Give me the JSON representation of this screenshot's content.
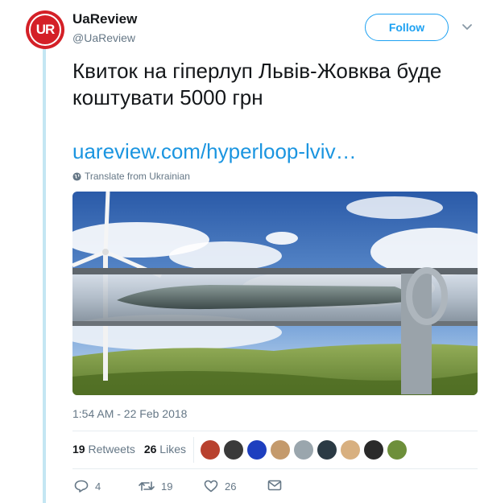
{
  "user": {
    "avatar_text": "UR",
    "name": "UaReview",
    "handle": "@UaReview"
  },
  "follow_label": "Follow",
  "tweet": {
    "line1": "Квиток на гіперлуп Львів-Жовква буде",
    "line2": "коштувати 5000 грн",
    "link": "uareview.com/hyperloop-lviv…",
    "translate_label": "Translate from Ukrainian"
  },
  "timestamp": "1:54 AM - 22 Feb 2018",
  "stats": {
    "retweets_count": "19",
    "retweets_label": "Retweets",
    "likes_count": "26",
    "likes_label": "Likes"
  },
  "likers": [
    {
      "color": "#b8412e"
    },
    {
      "color": "#3a3a3a"
    },
    {
      "color": "#1e3fbf"
    },
    {
      "color": "#c49a6c"
    },
    {
      "color": "#9aa6ad"
    },
    {
      "color": "#2b3a44"
    },
    {
      "color": "#d8b080"
    },
    {
      "color": "#2a2a2a"
    },
    {
      "color": "#6d8f3a"
    }
  ],
  "actions": {
    "reply_count": "4",
    "retweet_count": "19",
    "like_count": "26"
  },
  "colors": {
    "brand_blue": "#1da1f2",
    "link_blue": "#1b95e0",
    "muted": "#657786",
    "avatar_red": "#d42027"
  }
}
